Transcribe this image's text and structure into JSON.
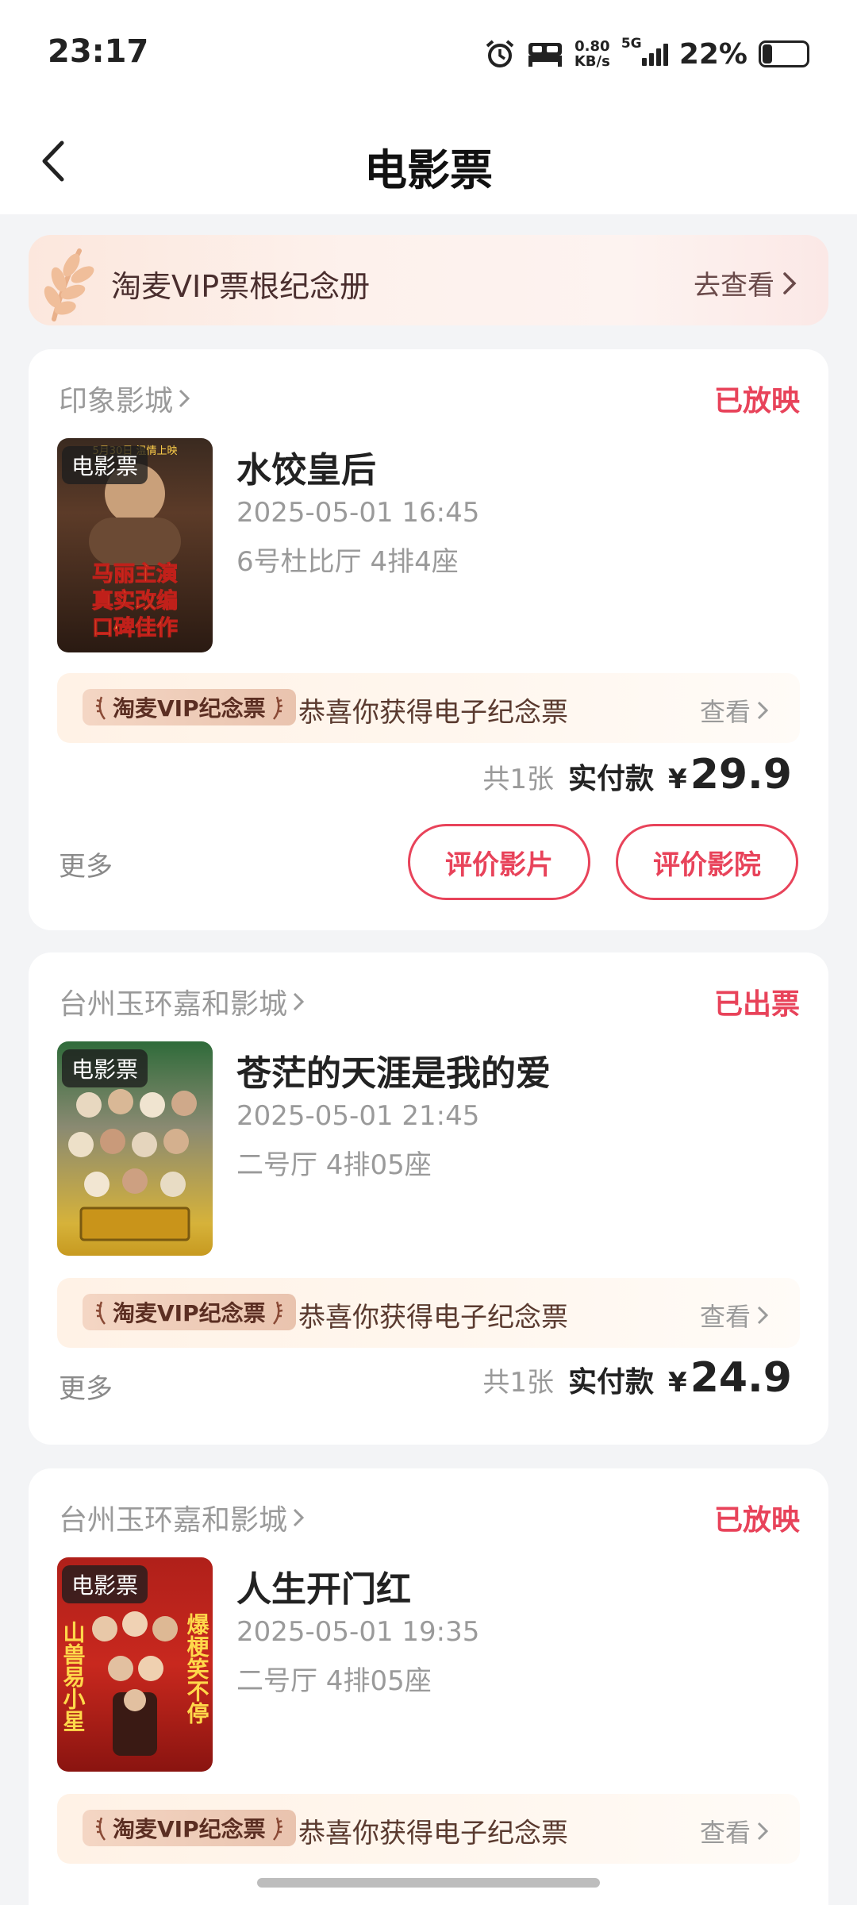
{
  "status_bar": {
    "time": "23:17",
    "net_speed_value": "0.80",
    "net_speed_unit": "KB/s",
    "network": "5G",
    "battery": "22%",
    "battery_level": 0.22
  },
  "header": {
    "title": "电影票"
  },
  "vip_banner": {
    "title": "淘麦VIP票根纪念册",
    "link": "去查看"
  },
  "common": {
    "poster_tag": "电影票",
    "souvenir_badge": "淘麦VIP纪念票",
    "souvenir_text": "恭喜你获得电子纪念票",
    "souvenir_link": "查看",
    "more": "更多",
    "price_label": "实付款",
    "currency": "¥",
    "review_movie": "评价影片",
    "review_cinema": "评价影院"
  },
  "orders": [
    {
      "cinema": "印象影城",
      "status": "已放映",
      "movie": "水饺皇后",
      "datetime": "2025-05-01 16:45",
      "seat": "6号杜比厅 4排4座",
      "count": "共1张",
      "price": "29.9",
      "poster_text": [
        "马丽主演",
        "真实改编",
        "口碑佳作"
      ],
      "poster_top": "5月30日 温情上映"
    },
    {
      "cinema": "台州玉环嘉和影城",
      "status": "已出票",
      "movie": "苍茫的天涯是我的爱",
      "datetime": "2025-05-01 21:45",
      "seat": "二号厅 4排05座",
      "count": "共1张",
      "price": "24.9"
    },
    {
      "cinema": "台州玉环嘉和影城",
      "status": "已放映",
      "movie": "人生开门红",
      "datetime": "2025-05-01 19:35",
      "seat": "二号厅 4排05座",
      "poster_left": "山兽易小星",
      "poster_right": "爆梗笑不停"
    }
  ],
  "colors": {
    "accent": "#E8435A",
    "page_bg": "#F3F4F6"
  }
}
